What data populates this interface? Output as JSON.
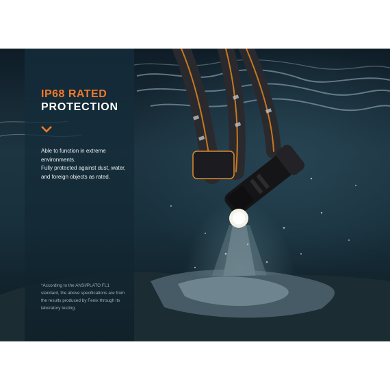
{
  "title": {
    "line1": "IP68 RATED",
    "line2": "PROTECTION"
  },
  "description": {
    "line1": "Able to function in extreme environments.",
    "line2": "Fully protected against dust, water, and foreign objects as rated."
  },
  "footnote": "*According to the ANSI/PLATO FL1 standard, the above specifications are from the results produced by Fenix through its laboratory testing.",
  "icons": [
    "chevron-down-icon"
  ],
  "colors": {
    "accent": "#f07a2a",
    "water_dark": "#0e1c26",
    "water_mid": "#1d3441"
  }
}
